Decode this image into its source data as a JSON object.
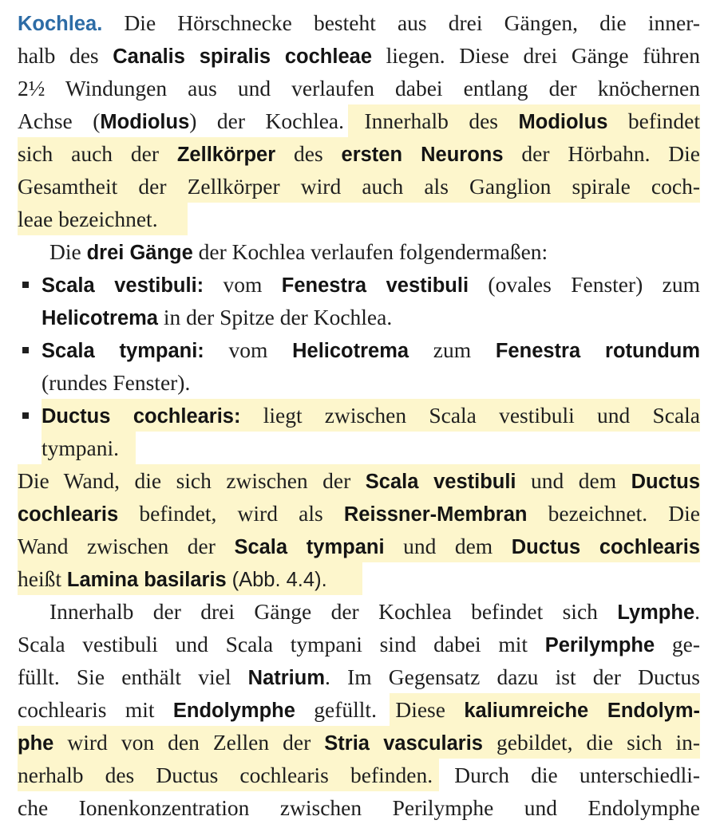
{
  "section": {
    "heading": "Kochlea.",
    "p1": {
      "l1": "Die Hörschnecke besteht aus drei Gängen, die inner-",
      "l2a": "halb des",
      "l2b": "Canalis spiralis cochleae",
      "l2c": "liegen. Diese drei Gänge führen",
      "l3": "2½ Windungen aus und verlaufen dabei entlang der knöchernen",
      "l4a": "Achse (",
      "l4b": "Modiolus",
      "l4c": ") der Kochlea.",
      "l4d": "Innerhalb des",
      "l4e": "Modiolus",
      "l4f": "befindet",
      "l5a": "sich auch der",
      "l5b": "Zellkörper",
      "l5c": "des",
      "l5d": "ersten Neurons",
      "l5e": "der Hörbahn. Die",
      "l6": "Gesamtheit der Zellkörper wird auch als Ganglion spirale coch-",
      "l7": "leae bezeichnet."
    },
    "p2": {
      "a": "Die",
      "b": "drei Gänge",
      "c": "der Kochlea verlaufen folgendermaßen:"
    },
    "bullets": [
      {
        "term": "Scala vestibuli:",
        "t1": "vom",
        "b1": "Fenestra vestibuli",
        "t2": "(ovales Fenster) zum",
        "b2": "Helicotrema",
        "t3": "in der Spitze der Kochlea."
      },
      {
        "term": "Scala tympani:",
        "t1": "vom",
        "b1": "Helicotrema",
        "t2": "zum",
        "b2": "Fenestra rotundum",
        "t3": "(rundes Fenster)."
      },
      {
        "term": "Ductus cochlearis:",
        "t1": "liegt zwischen Scala vestibuli und Scala",
        "t2": "tympani."
      }
    ],
    "p3": {
      "l1a": "Die Wand, die sich zwischen der",
      "l1b": "Scala vestibuli",
      "l1c": "und dem",
      "l1d": "Ductus",
      "l2a": "cochlearis",
      "l2b": "befindet, wird als",
      "l2c": "Reissner-Membran",
      "l2d": "bezeichnet. Die",
      "l3a": "Wand zwischen der",
      "l3b": "Scala tympani",
      "l3c": "und dem",
      "l3d": "Ductus cochlearis",
      "l4a": "heißt",
      "l4b": "Lamina basilaris",
      "l4c": "(Abb. 4.4)."
    },
    "p4": {
      "l1a": "Innerhalb der drei Gänge der Kochlea befindet sich",
      "l1b": "Lymphe",
      "l2a": "Scala vestibuli und Scala tympani sind dabei mit",
      "l2b": "Perilymphe",
      "l2c": "ge-",
      "l3a": "füllt. Sie enthält viel",
      "l3b": "Natrium",
      "l3c": ". Im Gegensatz dazu ist der Ductus",
      "l4a": "cochlearis mit",
      "l4b": "Endolymphe",
      "l4c": "gefüllt.",
      "l4d": "Diese",
      "l4e": "kaliumreiche Endolym-",
      "l5a": "phe",
      "l5b": "wird von den Zellen der",
      "l5c": "Stria vascularis",
      "l5d": "gebildet, die sich in-",
      "l6a": "nerhalb des Ductus cochlearis befinden.",
      "l6b": "Durch die unterschiedli-",
      "l7": "che Ionenkonzentration zwischen Perilymphe und Endolymphe"
    }
  }
}
